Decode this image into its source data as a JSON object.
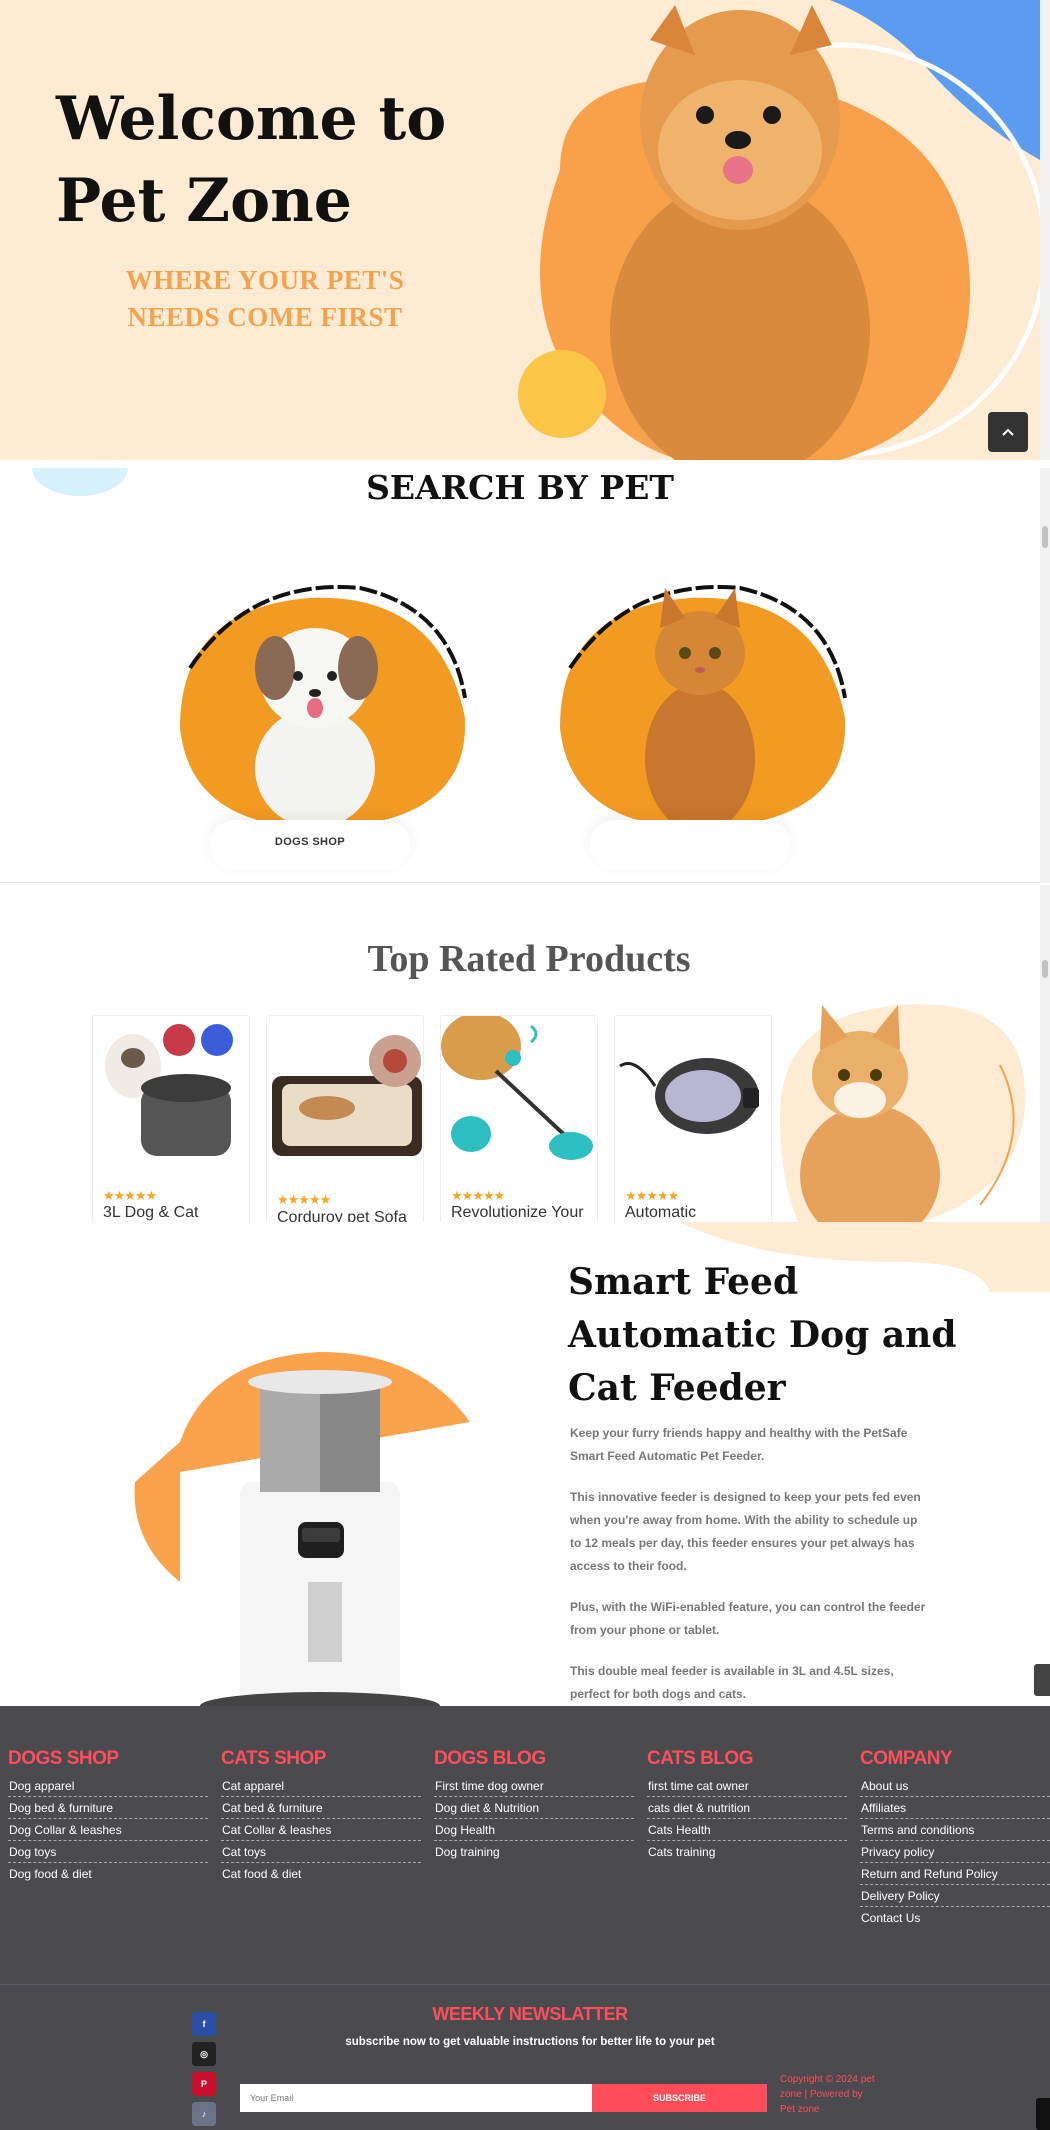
{
  "hero": {
    "title": "Welcome to Pet Zone",
    "subtitle": "WHERE YOUR PET'S NEEDS COME FIRST"
  },
  "search": {
    "title": "SEARCH BY PET",
    "cards": [
      {
        "label": "DOGS SHOP"
      },
      {
        "label": ""
      }
    ]
  },
  "top_rated": {
    "title": "Top Rated Products",
    "products": [
      {
        "name": "3L Dog & Cat",
        "rating": 5
      },
      {
        "name": "Corduroy pet Sofa",
        "rating": 5
      },
      {
        "name": "Revolutionize Your",
        "rating": 5
      },
      {
        "name": "Automatic",
        "rating": 5
      }
    ]
  },
  "feeder": {
    "title": "Smart Feed Automatic Dog and Cat Feeder",
    "paragraphs": [
      "Keep your furry friends happy and healthy with the PetSafe Smart Feed Automatic Pet Feeder.",
      "This innovative feeder is designed to keep your pets fed even when you're away from home. With the ability to schedule up to 12 meals per day, this feeder ensures your pet always has access to their food.",
      "Plus, with the WiFi-enabled feature, you can control the feeder from your phone or tablet.",
      "This double meal feeder is available in 3L and 4.5L sizes, perfect for both dogs and cats."
    ]
  },
  "footer": {
    "columns": [
      {
        "title": "DOGS SHOP",
        "links": [
          "Dog apparel",
          "Dog bed & furniture",
          "Dog Collar & leashes",
          "Dog toys",
          "Dog food & diet"
        ]
      },
      {
        "title": "CATS SHOP",
        "links": [
          "Cat apparel",
          "Cat bed & furniture",
          "Cat Collar & leashes",
          "Cat toys",
          "Cat food & diet"
        ]
      },
      {
        "title": "DOGS BLOG",
        "links": [
          "First time dog owner",
          "Dog diet & Nutrition",
          "Dog Health",
          "Dog training"
        ]
      },
      {
        "title": "CATS BLOG",
        "links": [
          "first time cat owner",
          "cats diet & nutrition",
          "Cats Health",
          "Cats training"
        ]
      },
      {
        "title": "COMPANY",
        "links": [
          "About us",
          "Affiliates",
          "Terms and conditions",
          "Privacy policy",
          "Return and Refund Policy",
          "Delivery Policy",
          "Contact Us"
        ]
      }
    ],
    "newsletter": {
      "title": "WEEKLY NEWSLATTER",
      "subtitle": "subscribe now to get valuable instructions for better life to your pet",
      "placeholder": "Your Email",
      "button": "SUBSCRIBE"
    },
    "copyright": "Copyright © 2024 pet zone | Powered by Pet zone",
    "social": [
      {
        "icon": "facebook-icon",
        "glyph": "f",
        "color": "#2b4fa8"
      },
      {
        "icon": "instagram-icon",
        "glyph": "◎",
        "color": "#222222"
      },
      {
        "icon": "pinterest-icon",
        "glyph": "P",
        "color": "#c8102e"
      },
      {
        "icon": "tiktok-icon",
        "glyph": "♪",
        "color": "#6b7388"
      }
    ]
  },
  "colors": {
    "hero_bg": "#fdebd3",
    "accent_orange": "#f4a24c",
    "accent_red": "#ff4d5a",
    "footer_bg": "#4a4a4f",
    "blue_blob": "#5b9cf0"
  }
}
